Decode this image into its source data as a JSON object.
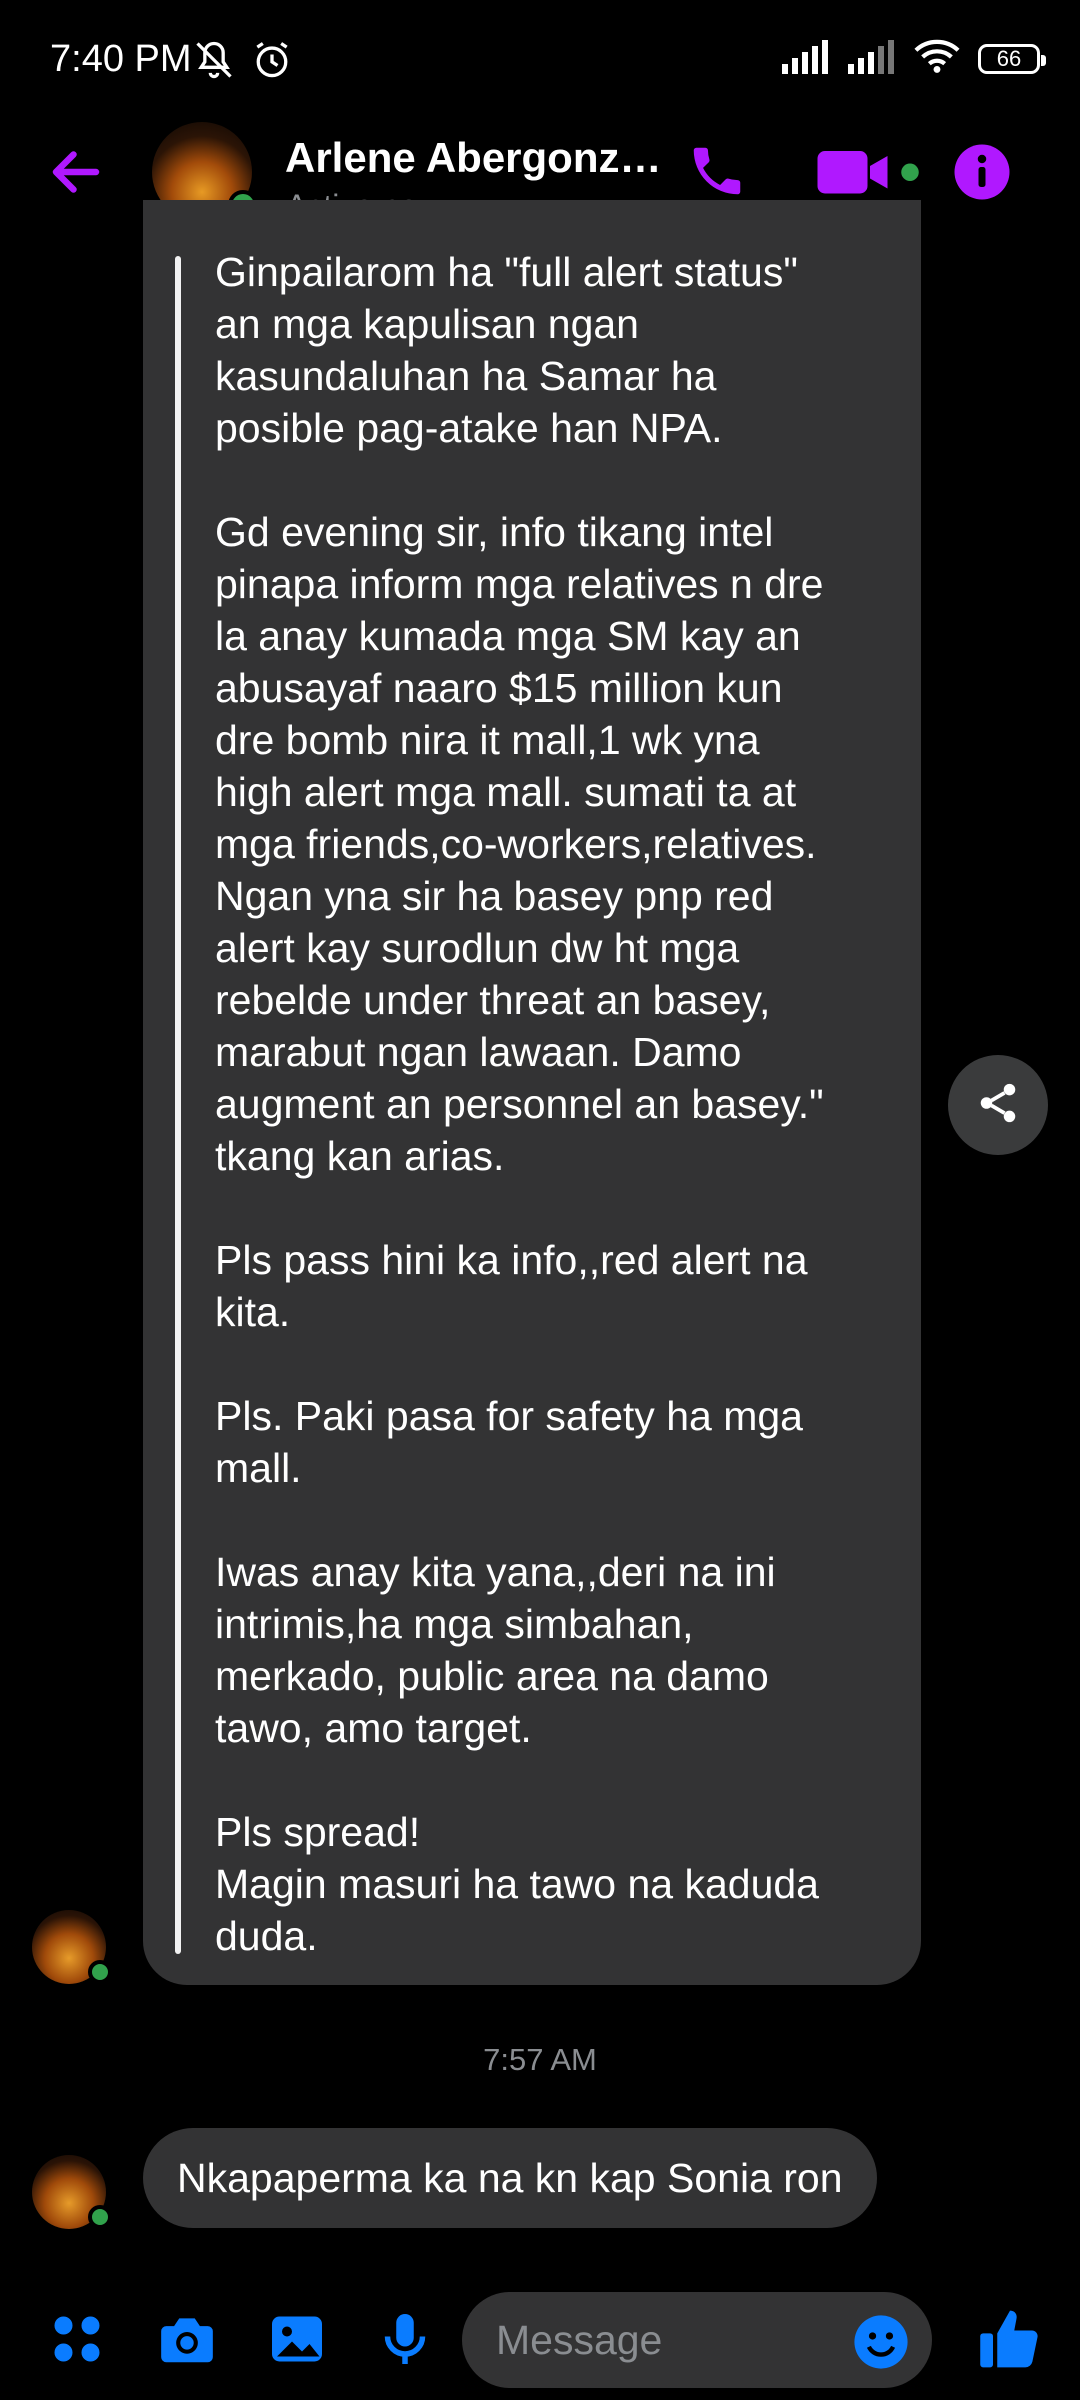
{
  "status_bar": {
    "time": "7:40 PM",
    "battery": "66",
    "left_icons": [
      "mute-bell-icon",
      "alarm-icon"
    ],
    "right_icons": [
      "signal-icon",
      "signal-icon",
      "wifi-icon",
      "battery-icon"
    ]
  },
  "header": {
    "contact_name": "Arlene Abergonz…",
    "status": "Active now",
    "accent_color": "#b018ff",
    "online_color": "#31a24c"
  },
  "forwarded_message": {
    "text": "Ginpailarom ha \"full alert status\"\nan mga kapulisan ngan\nkasundaluhan ha Samar ha\nposible pag-atake han NPA.\n\nGd evening sir, info tikang intel\npinapa inform mga relatives n dre\nla anay kumada mga SM kay an\nabusayaf naaro $15 million kun\ndre bomb nira it mall,1 wk yna\nhigh alert mga mall. sumati ta at\nmga friends,co-workers,relatives.\nNgan yna sir ha basey pnp red\nalert kay surodlun dw ht mga\nrebelde under threat an basey,\nmarabut ngan lawaan. Damo\naugment an personnel an basey.\"\ntkang kan arias.\n\nPls pass hini ka info,,red alert na\nkita.\n\nPls. Paki pasa for safety ha mga\nmall.\n\nIwas anay kita yana,,deri na ini\nintrimis,ha mga simbahan,\nmerkado, public area na damo\ntawo, amo target.\n\nPls spread!\nMagin masuri ha tawo na kaduda\nduda."
  },
  "timestamp": "7:57 AM",
  "last_message": "Nkapaperma ka na kn kap Sonia ron",
  "composer": {
    "placeholder": "Message",
    "icon_color": "#0a7cff"
  }
}
